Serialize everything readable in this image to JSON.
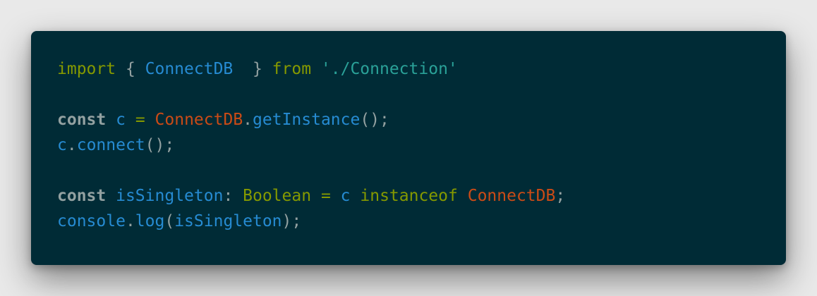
{
  "colors": {
    "background": "#002b36",
    "page_background": "#e9e9e9",
    "plain": "#93a1a1",
    "keyword_green": "#859900",
    "identifier_blue": "#268bd2",
    "class_orange": "#cb4b16",
    "string_teal": "#2aa198"
  },
  "code": {
    "lines": [
      {
        "tokens": [
          {
            "text": "import",
            "kind": "kw-green"
          },
          {
            "text": " { ",
            "kind": "punct"
          },
          {
            "text": "ConnectDB",
            "kind": "ident-blue"
          },
          {
            "text": "  } ",
            "kind": "punct"
          },
          {
            "text": "from",
            "kind": "kw-green"
          },
          {
            "text": " ",
            "kind": "punct"
          },
          {
            "text": "'./Connection'",
            "kind": "string"
          }
        ]
      },
      {
        "tokens": []
      },
      {
        "tokens": [
          {
            "text": "const",
            "kind": "kw-bold"
          },
          {
            "text": " ",
            "kind": "punct"
          },
          {
            "text": "c",
            "kind": "ident-blue"
          },
          {
            "text": " ",
            "kind": "punct"
          },
          {
            "text": "=",
            "kind": "kw-green"
          },
          {
            "text": " ",
            "kind": "punct"
          },
          {
            "text": "ConnectDB",
            "kind": "class-orange"
          },
          {
            "text": ".",
            "kind": "punct"
          },
          {
            "text": "getInstance",
            "kind": "ident-blue"
          },
          {
            "text": "();",
            "kind": "punct"
          }
        ]
      },
      {
        "tokens": [
          {
            "text": "c",
            "kind": "ident-blue"
          },
          {
            "text": ".",
            "kind": "punct"
          },
          {
            "text": "connect",
            "kind": "ident-blue"
          },
          {
            "text": "();",
            "kind": "punct"
          }
        ]
      },
      {
        "tokens": []
      },
      {
        "tokens": [
          {
            "text": "const",
            "kind": "kw-bold"
          },
          {
            "text": " ",
            "kind": "punct"
          },
          {
            "text": "isSingleton",
            "kind": "ident-blue"
          },
          {
            "text": ": ",
            "kind": "punct"
          },
          {
            "text": "Boolean",
            "kind": "kw-green"
          },
          {
            "text": " ",
            "kind": "punct"
          },
          {
            "text": "=",
            "kind": "kw-green"
          },
          {
            "text": " ",
            "kind": "punct"
          },
          {
            "text": "c",
            "kind": "ident-blue"
          },
          {
            "text": " ",
            "kind": "punct"
          },
          {
            "text": "instanceof",
            "kind": "kw-green"
          },
          {
            "text": " ",
            "kind": "punct"
          },
          {
            "text": "ConnectDB",
            "kind": "class-orange"
          },
          {
            "text": ";",
            "kind": "punct"
          }
        ]
      },
      {
        "tokens": [
          {
            "text": "console",
            "kind": "ident-blue"
          },
          {
            "text": ".",
            "kind": "punct"
          },
          {
            "text": "log",
            "kind": "ident-blue"
          },
          {
            "text": "(",
            "kind": "punct"
          },
          {
            "text": "isSingleton",
            "kind": "ident-blue"
          },
          {
            "text": ");",
            "kind": "punct"
          }
        ]
      }
    ]
  }
}
